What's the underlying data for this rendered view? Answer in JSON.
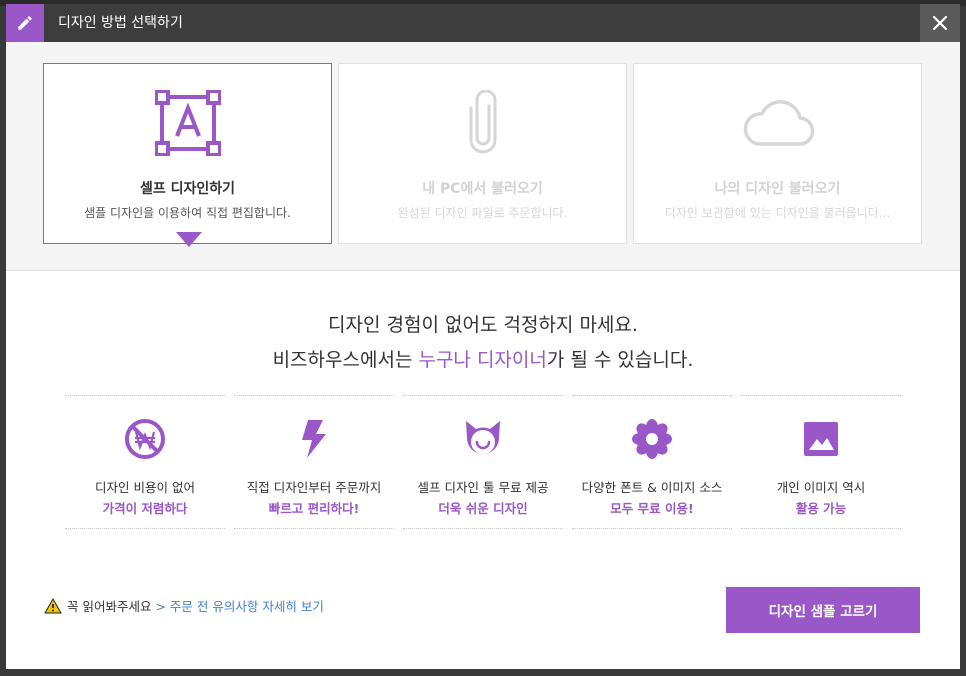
{
  "dialog": {
    "title": "디자인 방법 선택하기",
    "icon": "pencil-icon",
    "close_icon": "close-icon"
  },
  "cards": [
    {
      "title": "셀프 디자인하기",
      "desc": "샘플 디자인을 이용하여 직접 편집합니다.",
      "icon": "text-frame-icon",
      "state": "selected"
    },
    {
      "title": "내 PC에서 불러오기",
      "desc": "완성된 디자인 파일로 주문합니다.",
      "icon": "paperclip-icon",
      "state": "disabled"
    },
    {
      "title": "나의 디자인 불러오기",
      "desc": "디자인 보관함에 있는 디자인을 불러옵니다...",
      "icon": "cloud-icon",
      "state": "disabled"
    }
  ],
  "headline": {
    "line1": "디자인 경험이 없어도 걱정하지 마세요.",
    "line2_pre": "비즈하우스에서는 ",
    "line2_accent": "누구나 디자이너",
    "line2_post": "가 될 수 있습니다."
  },
  "features": [
    {
      "line1": "디자인 비용이 없어",
      "line2": "가격이 저렴하다",
      "icon": "no-won-icon"
    },
    {
      "line1": "직접 디자인부터 주문까지",
      "line2": "빠르고 편리하다!",
      "icon": "lightning-icon"
    },
    {
      "line1": "셀프 디자인 툴 무료 제공",
      "line2": "더욱 쉬운 디자인",
      "icon": "cat-face-icon"
    },
    {
      "line1": "다양한 폰트 & 이미지 소스",
      "line2": "모두 무료 이용!",
      "icon": "flower-icon"
    },
    {
      "line1": "개인 이미지 역시",
      "line2": "활용 가능",
      "icon": "image-icon"
    }
  ],
  "notice": {
    "text": "꼭 읽어봐주세요",
    "link": "> 주문 전 유의사항 자세히 보기",
    "icon": "warning-icon"
  },
  "primary_button": {
    "label": "디자인 샘플 고르기"
  },
  "colors": {
    "accent": "#9a57c8",
    "titlebar": "#3d3d3d",
    "link": "#3f7fd6"
  }
}
